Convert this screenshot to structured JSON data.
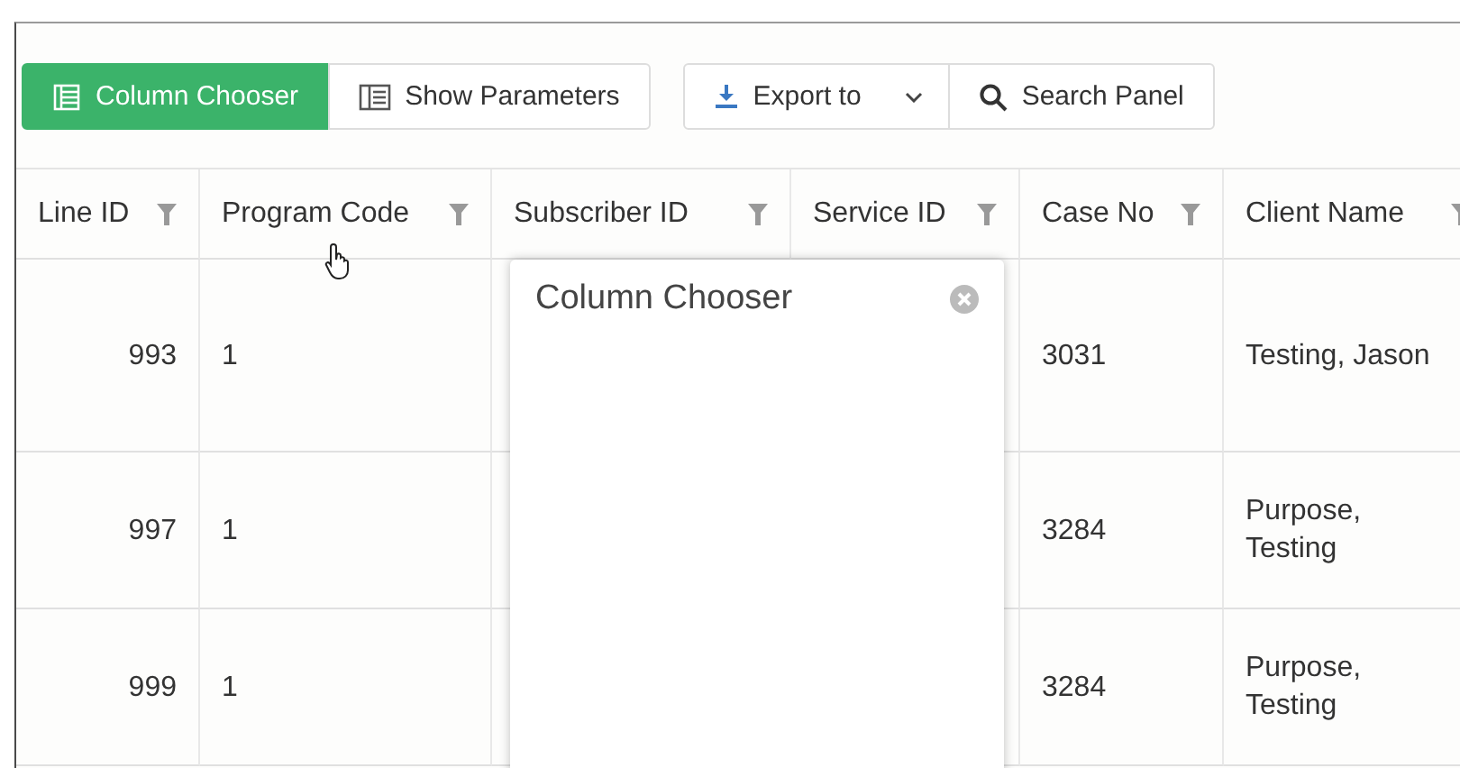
{
  "toolbar_groups": [
    {
      "buttons": [
        {
          "label": "Column Chooser",
          "kind": "toggle",
          "active": true
        },
        {
          "label": "Show Parameters",
          "kind": "toggle",
          "active": false
        }
      ]
    },
    {
      "buttons": [
        {
          "label": "Export to",
          "kind": "dropdown"
        },
        {
          "label": "Search Panel",
          "kind": "button"
        }
      ]
    }
  ],
  "grid": {
    "columns": [
      "Line ID",
      "Program Code",
      "Subscriber ID",
      "Service ID",
      "Case No",
      "Client Name"
    ],
    "rows": [
      {
        "cells": [
          "993",
          "1",
          "",
          "",
          "3031",
          "Testing, Jason"
        ]
      },
      {
        "cells": [
          "997",
          "1",
          "",
          "",
          "3284",
          "Purpose, Testing"
        ]
      },
      {
        "cells": [
          "999",
          "1",
          "",
          "",
          "3284",
          "Purpose, Testing"
        ]
      }
    ]
  },
  "popup": {
    "title": "Column Chooser"
  }
}
